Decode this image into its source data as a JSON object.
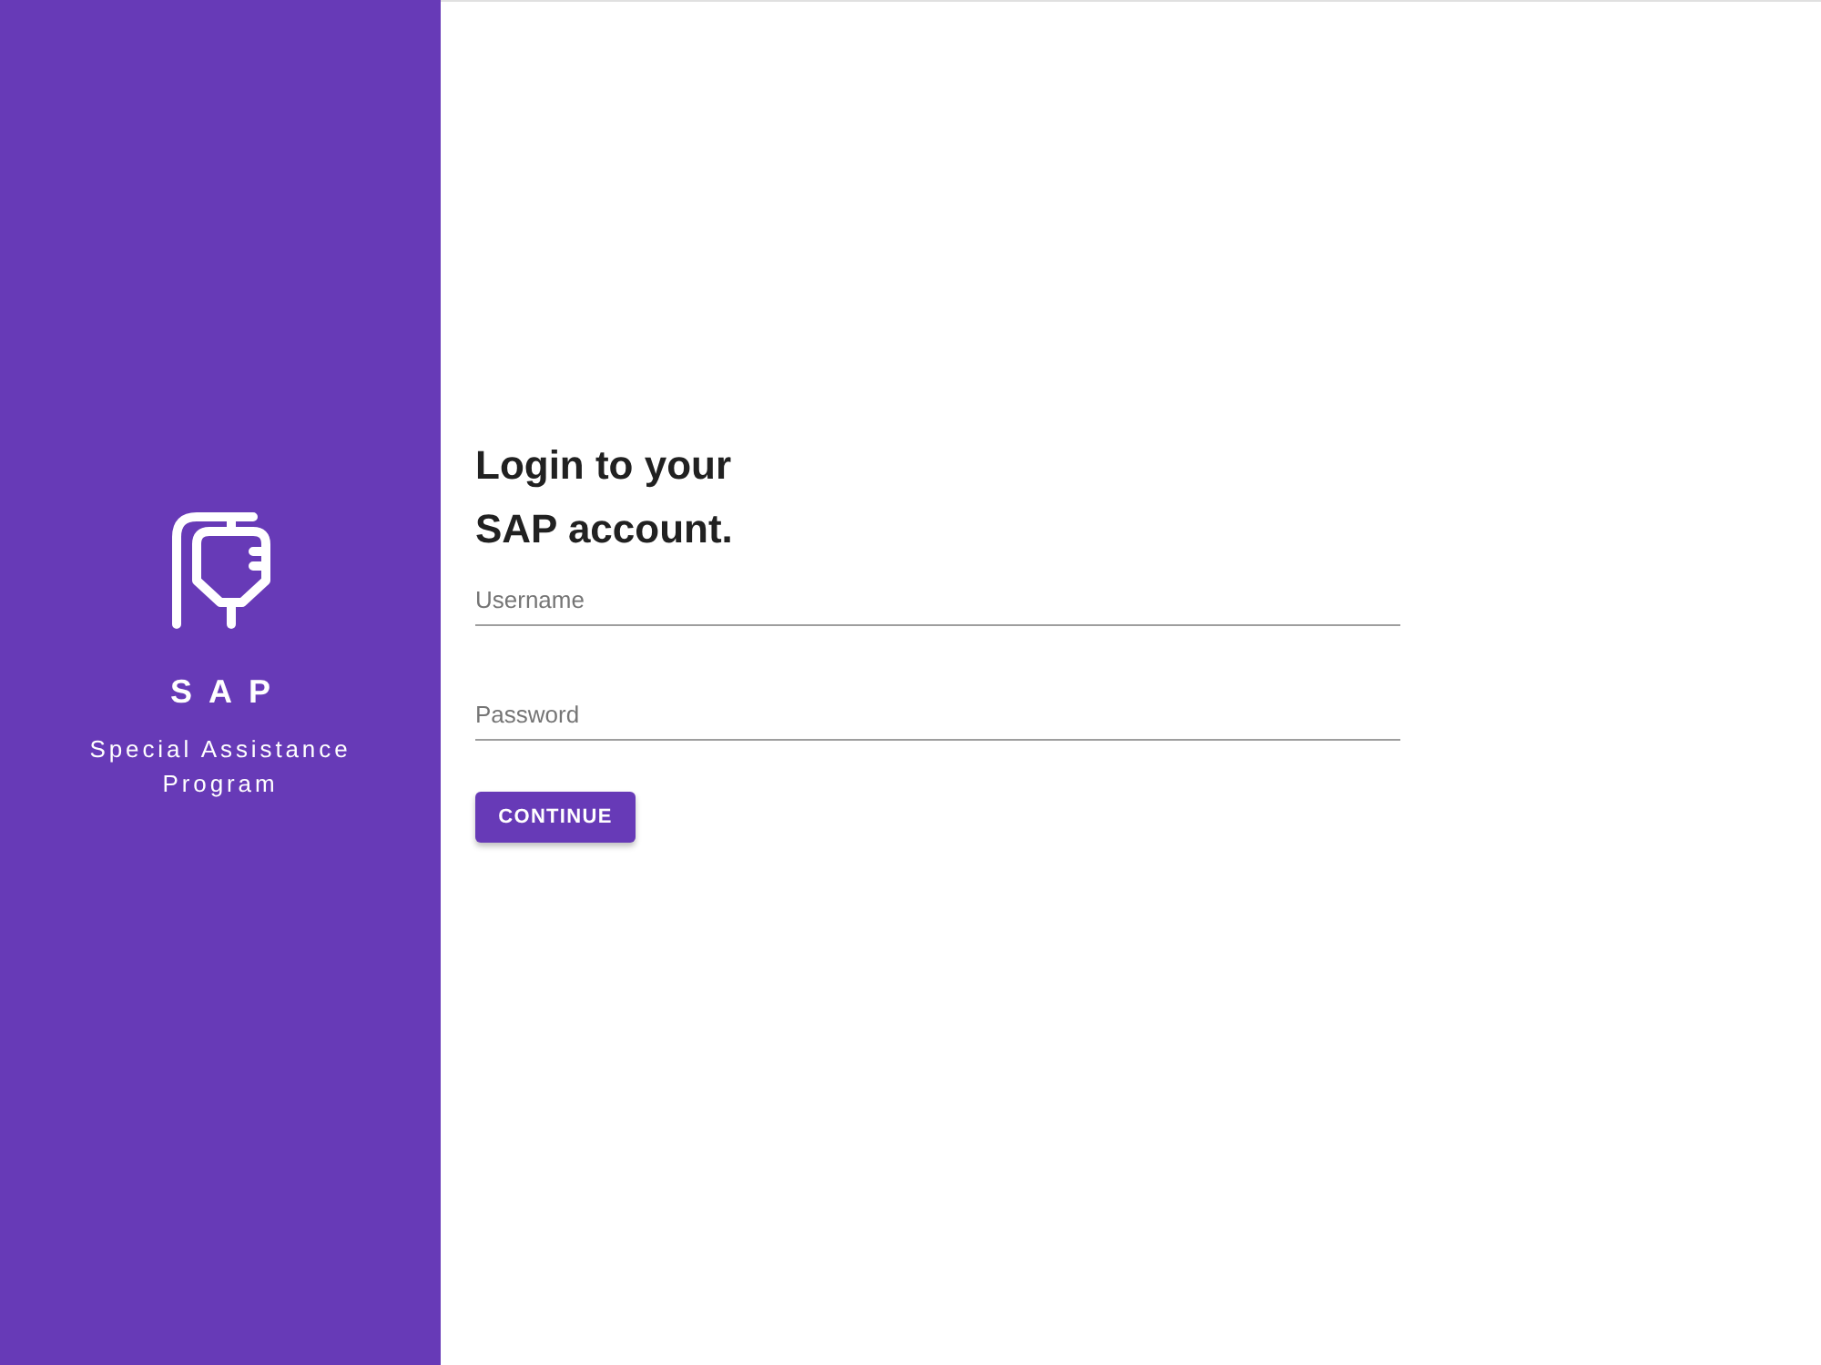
{
  "sidebar": {
    "logo_text": "SAP",
    "subtitle": "Special Assistance Program"
  },
  "login": {
    "heading": "Login to your\nSAP account.",
    "fields": [
      {
        "placeholder": "Username"
      },
      {
        "placeholder": "Password"
      }
    ],
    "button": "CONTINUE"
  }
}
